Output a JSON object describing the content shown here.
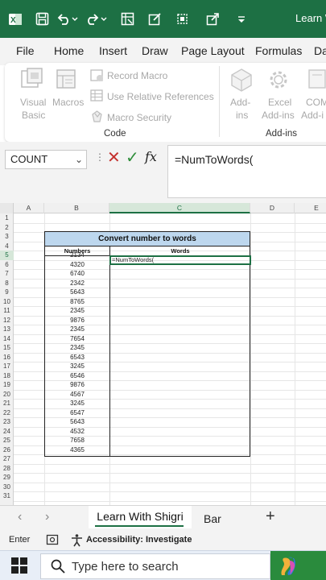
{
  "titlebar": {
    "title": "Learn W",
    "icons": [
      "excel-icon",
      "save-icon",
      "undo-icon",
      "redo-icon",
      "table-icon",
      "edit-icon",
      "shapes-icon",
      "chevron-icon"
    ]
  },
  "menu": {
    "tabs": [
      "File",
      "Home",
      "Insert",
      "Draw",
      "Page Layout",
      "Formulas",
      "Da"
    ]
  },
  "ribbon": {
    "code_group": {
      "visual_basic_1": "Visual",
      "visual_basic_2": "Basic",
      "macros": "Macros",
      "record_macro": "Record Macro",
      "use_relative": "Use Relative References",
      "macro_security": "Macro Security",
      "group_label": "Code"
    },
    "addins_group": {
      "addins_1": "Add-",
      "addins_2": "ins",
      "excel_addins_1": "Excel",
      "excel_addins_2": "Add-ins",
      "com_addins_1": "COM",
      "com_addins_2": "Add-i",
      "group_label": "Add-ins"
    }
  },
  "formula_bar": {
    "name_box": "COUNT",
    "name_arrow": "⌄",
    "dots": "⋮",
    "cancel": "✕",
    "enter": "✓",
    "fx": "fx",
    "formula": "=NumToWords("
  },
  "grid": {
    "columns": [
      "A",
      "B",
      "C",
      "D",
      "E"
    ],
    "active_column": "C",
    "rows": [
      "1",
      "2",
      "3",
      "4",
      "5",
      "6",
      "7",
      "8",
      "9",
      "10",
      "11",
      "12",
      "13",
      "14",
      "15",
      "16",
      "17",
      "18",
      "19",
      "20",
      "21",
      "22",
      "23",
      "24",
      "25",
      "26",
      "27",
      "28",
      "29",
      "30",
      "31"
    ],
    "active_row": "5",
    "table_title": "Convert number to words",
    "header_numbers": "Numbers",
    "header_words": "Words",
    "numbers": [
      "2134",
      "4320",
      "6740",
      "2342",
      "5643",
      "8765",
      "2345",
      "9876",
      "2345",
      "7654",
      "2345",
      "6543",
      "3245",
      "6546",
      "9876",
      "4567",
      "3245",
      "6547",
      "5643",
      "4532",
      "7658",
      "4365"
    ],
    "editing_text": "=NumToWords("
  },
  "sheets": {
    "prev": "‹",
    "next": "›",
    "active": "Learn With Shigri",
    "second": "Bar",
    "add": "+"
  },
  "status": {
    "mode": "Enter",
    "accessibility": "Accessibility: Investigate"
  },
  "taskbar": {
    "search_placeholder": "Type here to search"
  },
  "colors": {
    "excel_green": "#1d7044",
    "table_header_blue": "#bdd7ee",
    "cancel_red": "#c4312e",
    "enter_green": "#2e8d3a"
  }
}
